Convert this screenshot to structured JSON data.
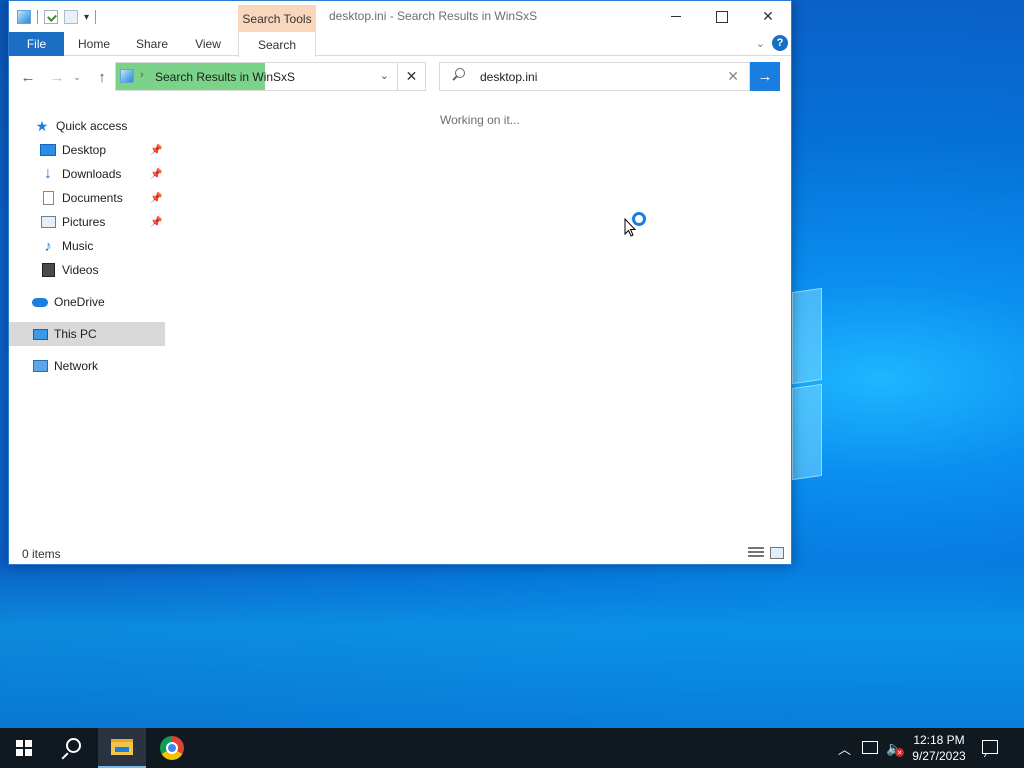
{
  "window": {
    "title": "desktop.ini - Search Results in WinSxS",
    "context_tab": "Search Tools"
  },
  "ribbon": {
    "tabs": [
      "File",
      "Home",
      "Share",
      "View",
      "Search"
    ],
    "help": "?"
  },
  "address_bar": {
    "path": "Search Results in WinSxS",
    "progress": 0.53
  },
  "search": {
    "value": "desktop.ini"
  },
  "nav_pane": {
    "quick_access": "Quick access",
    "items": [
      {
        "label": "Desktop",
        "icon": "desktop-icon",
        "pinned": true
      },
      {
        "label": "Downloads",
        "icon": "downloads-icon",
        "pinned": true
      },
      {
        "label": "Documents",
        "icon": "documents-icon",
        "pinned": true
      },
      {
        "label": "Pictures",
        "icon": "pictures-icon",
        "pinned": true
      },
      {
        "label": "Music",
        "icon": "music-icon",
        "pinned": false
      },
      {
        "label": "Videos",
        "icon": "videos-icon",
        "pinned": false
      }
    ],
    "onedrive": "OneDrive",
    "this_pc": "This PC",
    "network": "Network",
    "selected": "This PC"
  },
  "content": {
    "status_message": "Working on it..."
  },
  "status_bar": {
    "item_count": "0 items"
  },
  "taskbar": {
    "pinned": [
      "start-icon",
      "search-icon",
      "file-explorer-icon",
      "chrome-icon"
    ],
    "clock_time": "12:18 PM",
    "clock_date": "9/27/2023"
  },
  "colors": {
    "accent": "#1a7de0",
    "file_tab": "#1a6fc4",
    "context_tab": "#f9d7bd",
    "progress_fill": "#7bd38a",
    "taskbar": "#101820"
  }
}
